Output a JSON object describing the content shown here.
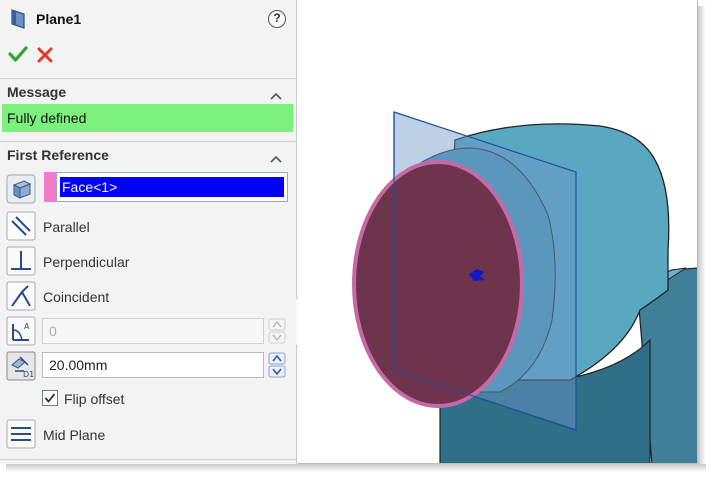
{
  "panel": {
    "title": "Plane1",
    "help_label": "?",
    "icons": {
      "plane": "plane-feature-icon",
      "help": "help-icon",
      "ok": "checkmark-icon",
      "cancel": "close-icon"
    },
    "message_section": {
      "label": "Message",
      "text": "Fully defined",
      "color": "#7cf07c"
    },
    "first_reference": {
      "label": "First Reference",
      "selection": "Face<1>",
      "swatch_color": "#f07cc8",
      "options": [
        {
          "label": "Parallel",
          "icon": "parallel-icon"
        },
        {
          "label": "Perpendicular",
          "icon": "perpendicular-icon"
        },
        {
          "label": "Coincident",
          "icon": "coincident-icon"
        }
      ],
      "angle_value": "0",
      "offset_value": "20.00mm",
      "flip_offset": {
        "label": "Flip offset",
        "checked": true
      },
      "mid_plane": {
        "label": "Mid Plane",
        "icon": "mid-plane-icon"
      }
    }
  },
  "colors": {
    "accent_select": "#0000ff",
    "part_body": "#5aa7c2",
    "face_highlight": "#6e344e",
    "plane_fill": "#6f97c8"
  }
}
